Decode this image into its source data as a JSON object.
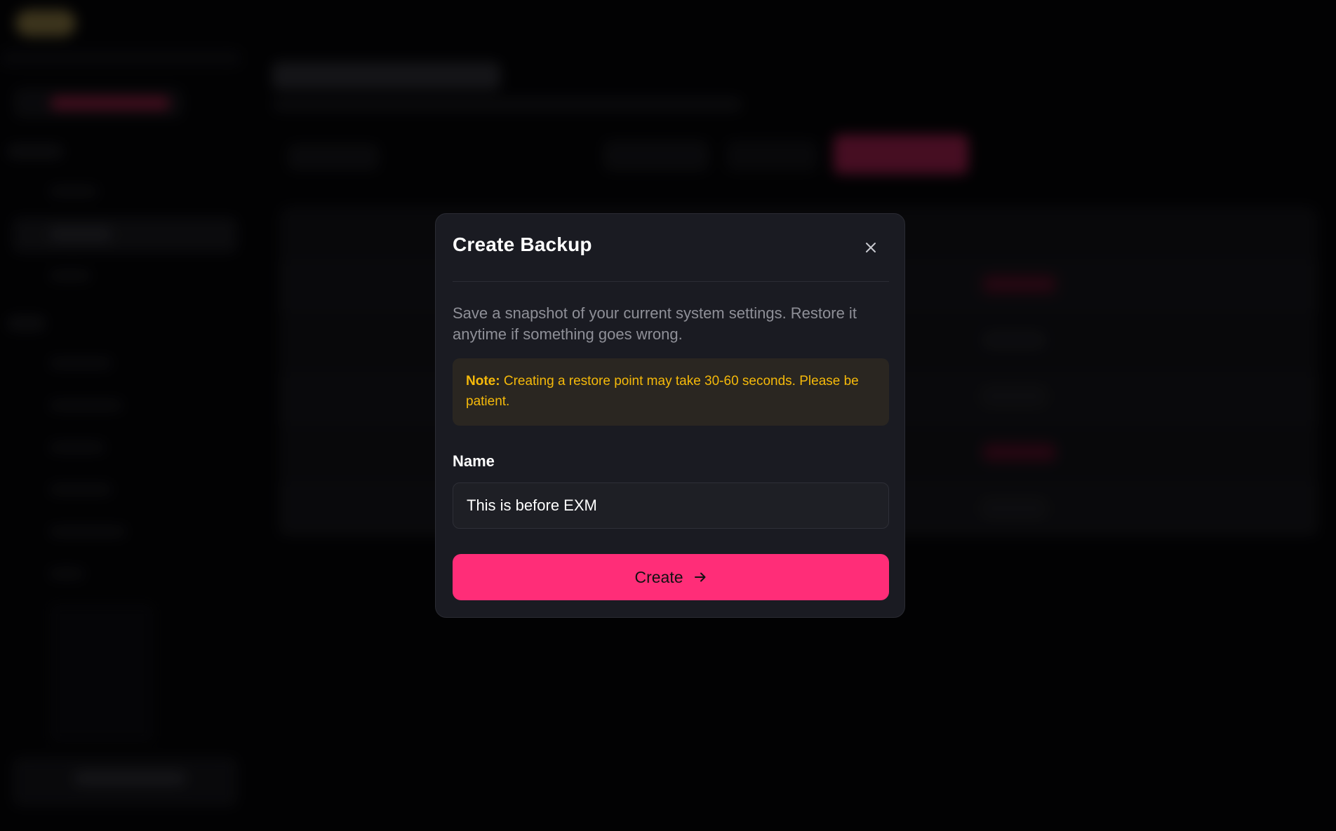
{
  "modal": {
    "title": "Create Backup",
    "description": "Save a snapshot of your current system settings. Restore it anytime if something goes wrong.",
    "note_label": "Note:",
    "note_text": "Creating a restore point may take 30-60 seconds. Please be patient.",
    "name_label": "Name",
    "name_value": "This is before EXM",
    "create_label": "Create",
    "icons": {
      "close": "close-icon",
      "create": "arrow-right-icon"
    }
  },
  "colors": {
    "accent": "#ff2d78",
    "note_text": "#f5b90a",
    "note_background": "#2a2621",
    "modal_background": "#1a1b22",
    "page_background": "#050507"
  }
}
